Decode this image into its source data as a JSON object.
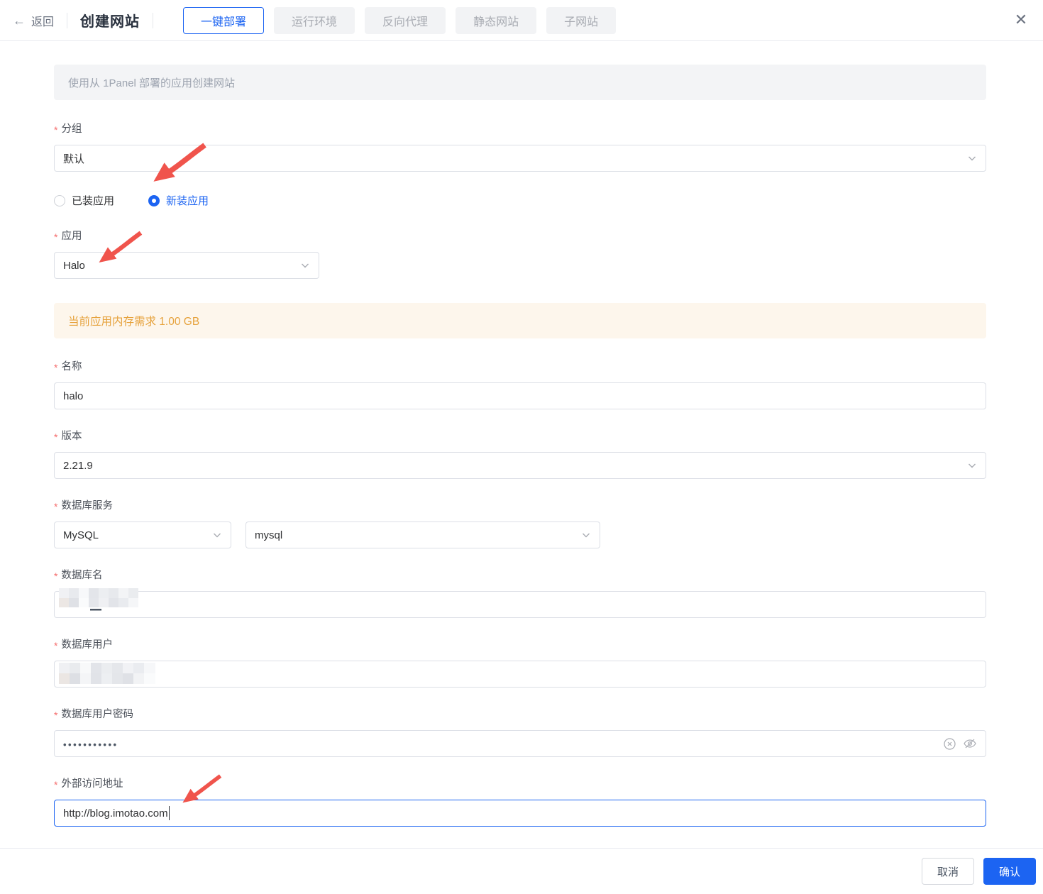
{
  "header": {
    "back_label": "返回",
    "title": "创建网站",
    "tabs": [
      {
        "label": "一键部署",
        "active": true
      },
      {
        "label": "运行环境",
        "active": false
      },
      {
        "label": "反向代理",
        "active": false
      },
      {
        "label": "静态网站",
        "active": false
      },
      {
        "label": "子网站",
        "active": false
      }
    ],
    "close_icon": "x-icon"
  },
  "banner": {
    "text": "使用从 1Panel 部署的应用创建网站"
  },
  "form": {
    "group": {
      "label": "分组",
      "required": true,
      "value": "默认"
    },
    "install_type": {
      "options": [
        {
          "label": "已装应用",
          "selected": false
        },
        {
          "label": "新装应用",
          "selected": true
        }
      ]
    },
    "app": {
      "label": "应用",
      "required": true,
      "value": "Halo"
    },
    "memory_notice": "当前应用内存需求 1.00 GB",
    "name": {
      "label": "名称",
      "required": true,
      "value": "halo"
    },
    "version": {
      "label": "版本",
      "required": true,
      "value": "2.21.9"
    },
    "db_service": {
      "label": "数据库服务",
      "required": true,
      "type_value": "MySQL",
      "instance_value": "mysql"
    },
    "db_name": {
      "label": "数据库名",
      "required": true,
      "value_redacted": true
    },
    "db_user": {
      "label": "数据库用户",
      "required": true,
      "value_redacted": true
    },
    "db_password": {
      "label": "数据库用户密码",
      "required": true,
      "masked_value": "•••••••••••"
    },
    "external_url": {
      "label": "外部访问地址",
      "required": true,
      "value": "http://blog.imotao.com",
      "focused": true
    }
  },
  "footer": {
    "cancel_label": "取消",
    "confirm_label": "确认"
  },
  "colors": {
    "accent": "#1c64f2",
    "warning_text": "#e6a23c",
    "warning_bg": "#fdf6ec",
    "required_red": "#f56c6c",
    "annotation_arrow": "#f0544c",
    "inactive_tab_bg": "#f2f3f5"
  },
  "icons": [
    "arrow-left-icon",
    "x-icon",
    "chevron-down-icon",
    "circle-x-icon",
    "eye-off-icon",
    "red-arrow-annotation"
  ]
}
